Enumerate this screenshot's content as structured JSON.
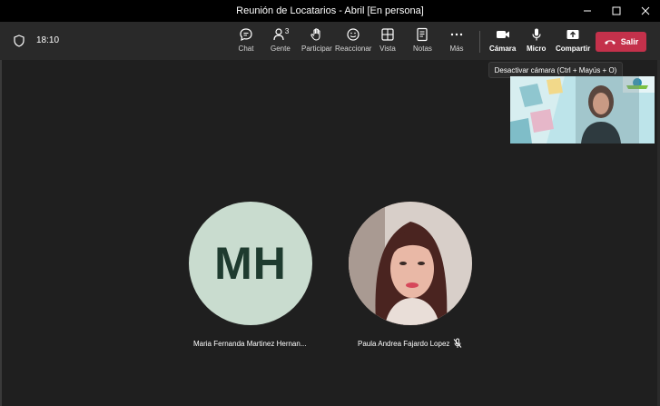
{
  "window": {
    "title": "Reunión de Locatarios - Abril [En persona]",
    "controls": [
      "minimize-icon",
      "maximize-icon",
      "close-icon"
    ]
  },
  "toolbar": {
    "elapsed": "18:10",
    "people_count": "3",
    "buttons": {
      "chat": "Chat",
      "people": "Gente",
      "raise": "Participar",
      "react": "Reaccionar",
      "view": "Vista",
      "notes": "Notas",
      "more": "Más",
      "camera": "Cámara",
      "mic": "Micro",
      "share": "Compartir"
    },
    "leave": "Salir"
  },
  "tooltip": "Desactivar cámara (Ctrl + Mayús + O)",
  "participants": [
    {
      "initials": "MH",
      "name": "Maria Fernanda Martinez Hernan...",
      "avatar_color": "#c9dccf"
    },
    {
      "name": "Paula Andrea Fajardo Lopez",
      "muted": true
    }
  ],
  "colors": {
    "leave": "#c4314b",
    "stage": "#1f1f1f",
    "toolbar": "#292929"
  }
}
